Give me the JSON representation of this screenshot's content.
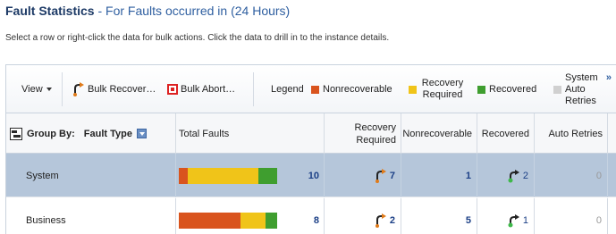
{
  "header": {
    "title": "Fault Statistics",
    "subtitle": " - For Faults occurred in (24 Hours)",
    "instructions": "Select a row or right-click the data for bulk actions. Click the data to drill in to the instance details."
  },
  "toolbar": {
    "view_label": "View",
    "bulk_recover_label": "Bulk Recover…",
    "bulk_abort_label": "Bulk Abort…",
    "legend_label": "Legend",
    "legend": [
      {
        "label": "Nonrecoverable",
        "color": "#d9541e"
      },
      {
        "label": "Recovery Required",
        "color": "#f0c419"
      },
      {
        "label": "Recovered",
        "color": "#3f9e2f"
      },
      {
        "label": "System Auto Retries",
        "color": "#d0d0d0"
      }
    ],
    "more_label": "»"
  },
  "table": {
    "group_by_label": "Group By:",
    "group_by_value": "Fault Type",
    "columns": {
      "total_faults": "Total Faults",
      "recovery_required": "Recovery Required",
      "nonrecoverable": "Nonrecoverable",
      "recovered": "Recovered",
      "auto_retries": "Auto Retries"
    },
    "rows": [
      {
        "name": "System",
        "selected": true,
        "total": "10",
        "bar": [
          0.09,
          0.72,
          0.19
        ],
        "recovery_required": "7",
        "nonrecoverable": "1",
        "recovered": "2",
        "auto_retries": "0"
      },
      {
        "name": "Business",
        "selected": false,
        "total": "8",
        "bar": [
          0.63,
          0.25,
          0.12
        ],
        "recovery_required": "2",
        "nonrecoverable": "5",
        "recovered": "1",
        "auto_retries": "0"
      }
    ]
  },
  "colors": {
    "nonrecoverable": "#d9541e",
    "recovery_required": "#f0c419",
    "recovered": "#3f9e2f",
    "selected_row": "#b5c6da"
  },
  "icons": {
    "recover": "recover-arrow-icon",
    "abort": "abort-icon",
    "group": "group-by-icon",
    "recovered": "recovered-arrow-icon"
  }
}
